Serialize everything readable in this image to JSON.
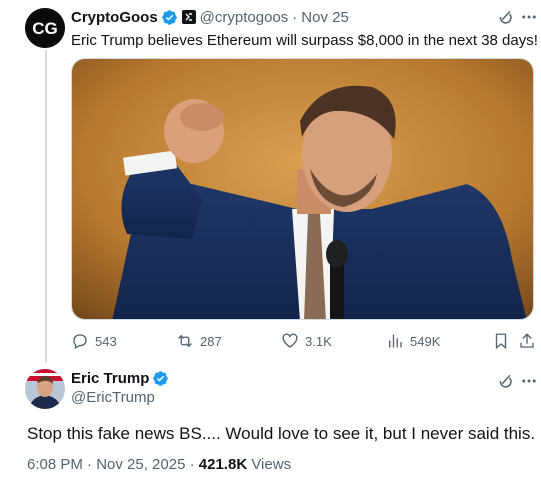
{
  "quoted_tweet": {
    "author_name": "CryptoGoos",
    "author_handle": "@cryptogoos",
    "separator": "·",
    "date": "Nov 25",
    "avatar_text": "CG",
    "text": "Eric Trump believes Ethereum will surpass $8,000 in the next 38 days!",
    "stats": {
      "replies": "543",
      "reposts": "287",
      "likes": "3.1K",
      "views": "549K"
    }
  },
  "main_tweet": {
    "author_name": "Eric Trump",
    "author_handle": "@EricTrump",
    "text": "Stop this fake news BS.... Would love to see it, but I never said this.",
    "time": "6:08 PM · Nov 25, 2025",
    "separator": "·",
    "views_count": "421.8K",
    "views_label": "Views"
  },
  "colors": {
    "verified_blue": "#1d9bf0",
    "secondary_text": "#536471",
    "primary_text": "#0f1419",
    "thread_line": "#cfd9de"
  },
  "icons": [
    "verified-badge-icon",
    "affiliate-badge-icon",
    "grok-icon",
    "more-icon",
    "reply-icon",
    "repost-icon",
    "like-icon",
    "views-icon",
    "bookmark-icon",
    "share-icon"
  ]
}
